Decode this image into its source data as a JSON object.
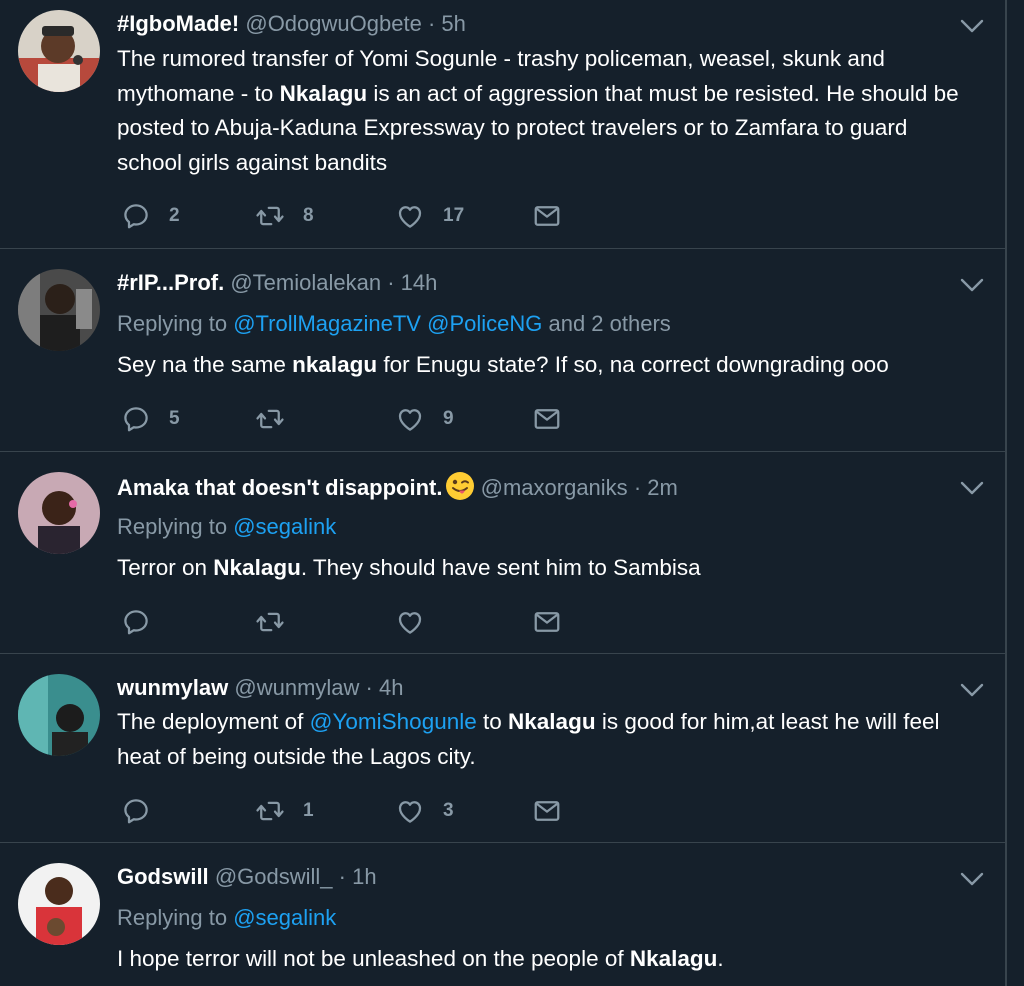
{
  "colors": {
    "background": "#15202b",
    "divider": "#38444d",
    "muted": "#8899a6",
    "link": "#1da1f2",
    "text": "#ffffff"
  },
  "tweets": [
    {
      "display_name": "#IgboMade!",
      "handle": "@OdogwuOgbete",
      "dot": "·",
      "time": "5h",
      "reply": null,
      "body": {
        "t1": "The rumored transfer of Yomi Sogunle - trashy policeman, weasel, skunk and mythomane - to ",
        "b1": "Nkalagu",
        "t2": " is an act of aggression that must be resisted. He should be posted to Abuja-Kaduna Expressway to protect travelers or to Zamfara to guard school girls against bandits"
      },
      "replies": "2",
      "retweets": "8",
      "likes": "17"
    },
    {
      "display_name": "#rIP...Prof.",
      "handle": "@Temiolalekan",
      "dot": "·",
      "time": "14h",
      "reply": {
        "prefix": "Replying to ",
        "mention1": "@TrollMagazineTV",
        "mention2": "@PoliceNG",
        "suffix": " and 2 others"
      },
      "body": {
        "t1": "Sey na the same ",
        "b1": "nkalagu",
        "t2": " for Enugu state? If so, na correct downgrading ooo"
      },
      "replies": "5",
      "retweets": "",
      "likes": "9"
    },
    {
      "display_name": "Amaka that doesn't disappoint.",
      "emoji": "winking-face-with-tongue",
      "handle": "@maxorganiks",
      "dot": "·",
      "time": "2m",
      "reply": {
        "prefix": "Replying to ",
        "mention1": "@segalink"
      },
      "body": {
        "t1": "Terror on ",
        "b1": "Nkalagu",
        "t2": ". They should have sent him to Sambisa"
      },
      "replies": "",
      "retweets": "",
      "likes": ""
    },
    {
      "display_name": "wunmylaw",
      "handle": "@wunmylaw",
      "dot": "·",
      "time": "4h",
      "reply": null,
      "body": {
        "t1": "The deployment of ",
        "m1": "@YomiShogunle",
        "t2": " to ",
        "b1": "Nkalagu",
        "t3": " is good for him,at least he will feel heat of being outside the Lagos city."
      },
      "replies": "",
      "retweets": "1",
      "likes": "3"
    },
    {
      "display_name": "Godswill",
      "handle": "@Godswill_",
      "dot": "·",
      "time": "1h",
      "reply": {
        "prefix": "Replying to ",
        "mention1": "@segalink"
      },
      "body": {
        "t1": "I hope terror will not be unleashed on the people of ",
        "b1": "Nkalagu",
        "t2": "."
      }
    }
  ]
}
